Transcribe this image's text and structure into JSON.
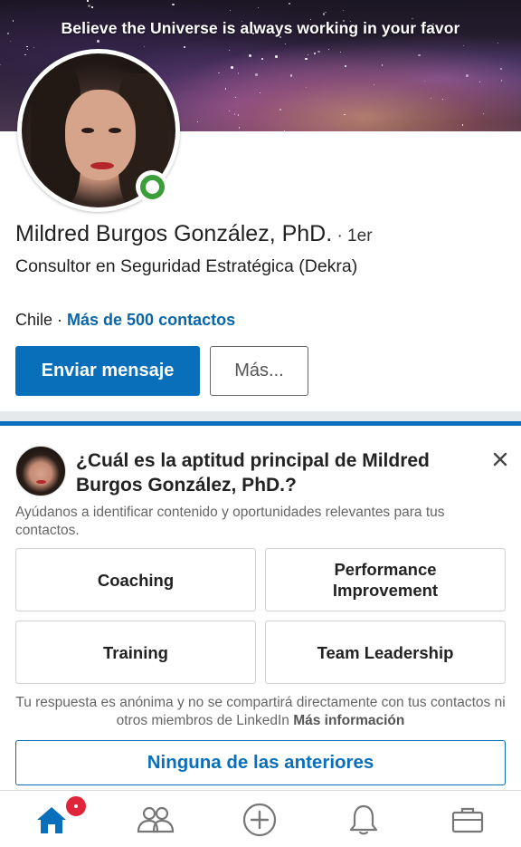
{
  "banner": {
    "tagline": "Believe the Universe is always working in your favor"
  },
  "profile": {
    "name": "Mildred Burgos González, PhD.",
    "degree": " · 1er",
    "headline": "Consultor en Seguridad Estratégica (Dekra)",
    "location": "Chile · ",
    "contacts": "Más de 500 contactos",
    "online_status_color": "#3c9e3a"
  },
  "actions": {
    "message_label": "Enviar mensaje",
    "more_label": "Más..."
  },
  "skill_prompt": {
    "question": "¿Cuál es la aptitud principal de Mildred Burgos González, PhD.?",
    "helper": "Ayúdanos a identificar contenido y oportunidades relevantes para tus contactos.",
    "options": [
      "Coaching",
      "Performance Improvement",
      "Training",
      "Team Leadership"
    ],
    "disclaimer": "Tu respuesta es anónima y no se compartirá directamente con tus contactos ni otros miembros de LinkedIn ",
    "more_info": "Más información",
    "none_label": "Ninguna de las anteriores",
    "close_icon": "close-icon"
  },
  "nav": {
    "items": [
      {
        "name": "home",
        "icon": "home-icon",
        "active": true
      },
      {
        "name": "network",
        "icon": "people-icon",
        "active": false
      },
      {
        "name": "post",
        "icon": "plus-circle-icon",
        "active": false
      },
      {
        "name": "notifications",
        "icon": "bell-icon",
        "active": false
      },
      {
        "name": "jobs",
        "icon": "briefcase-icon",
        "active": false
      }
    ],
    "active_color": "#0a6fba",
    "inactive_color": "#777777",
    "badge_color": "#e0243a"
  },
  "colors": {
    "accent": "#0a6fba",
    "link": "#0a66a8"
  }
}
